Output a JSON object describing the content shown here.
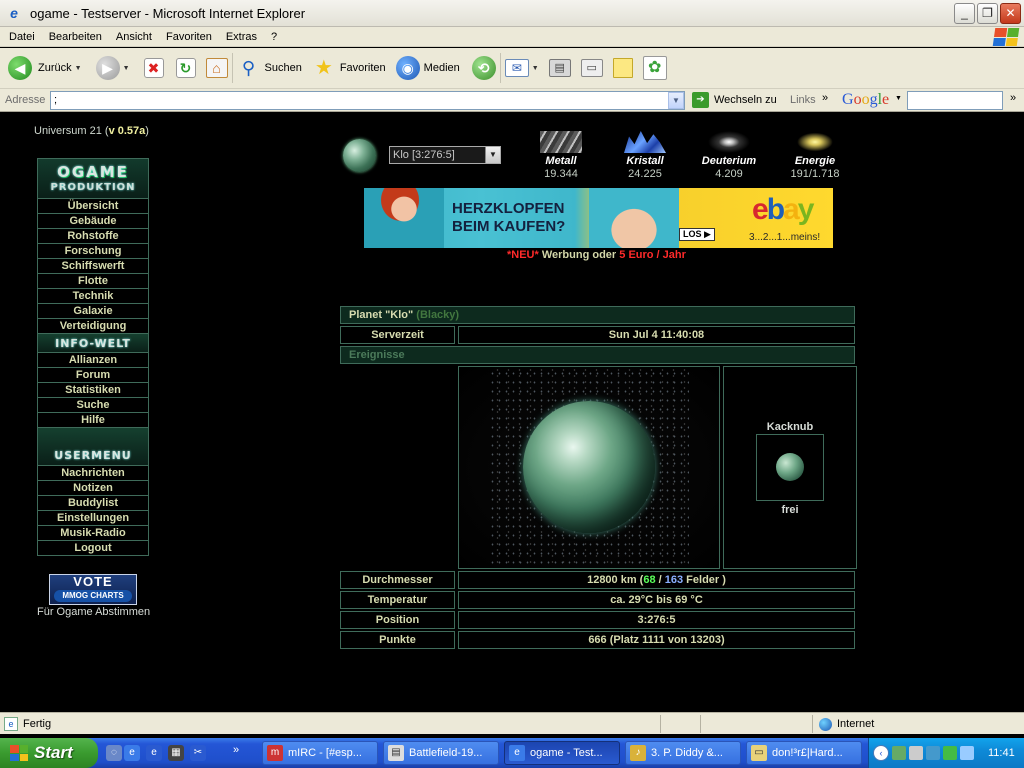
{
  "window": {
    "title": "ogame - Testserver - Microsoft Internet Explorer"
  },
  "menu": [
    "Datei",
    "Bearbeiten",
    "Ansicht",
    "Favoriten",
    "Extras",
    "?"
  ],
  "toolbar": {
    "back": "Zurück",
    "search": "Suchen",
    "favorites": "Favoriten",
    "media": "Medien"
  },
  "address": {
    "label": "Adresse",
    "value": ";",
    "go": "Wechseln zu",
    "links": "Links",
    "google": "Google"
  },
  "page": {
    "universe": {
      "label": "Universum 21 (",
      "version": "v 0.57a",
      "close": ")"
    },
    "sidebar": {
      "header_top": "OGAME",
      "header_bottom": "PRODUKTION",
      "production": [
        "Übersicht",
        "Gebäude",
        "Rohstoffe",
        "Forschung",
        "Schiffswerft",
        "Flotte",
        "Technik",
        "Galaxie",
        "Verteidigung"
      ],
      "info_header": "INFO-WELT",
      "info": [
        "Allianzen",
        "Forum",
        "Statistiken",
        "Suche",
        "Hilfe"
      ],
      "user_header": "USERMENU",
      "user": [
        "Nachrichten",
        "Notizen",
        "Buddylist",
        "Einstellungen",
        "Musik-Radio",
        "Logout"
      ],
      "vote_top": "VOTE",
      "vote_bottom": "MMOG CHARTS",
      "vote_text": "Für Ogame Abstimmen"
    },
    "planet_select": "Klo [3:276:5]",
    "resources": [
      {
        "name": "Metall",
        "value": "19.344"
      },
      {
        "name": "Kristall",
        "value": "24.225"
      },
      {
        "name": "Deuterium",
        "value": "4.209"
      },
      {
        "name": "Energie",
        "value": "191/1.718"
      }
    ],
    "banner": {
      "line1": "HERZKLOPFEN",
      "line2": "BEIM KAUFEN?",
      "button": "LOS ▶",
      "slogan": "3...2...1...meins!"
    },
    "adline": {
      "new": "*NEU*",
      "middle": " Werbung oder ",
      "price": "5 Euro / Jahr"
    },
    "overview": {
      "planet_title": "Planet \"Klo\"",
      "owner": "(Blacky)",
      "servertime_label": "Serverzeit",
      "servertime": "Sun Jul 4 11:40:08",
      "events_label": "Ereignisse",
      "moon_name": "Kacknub",
      "moon_status": "frei",
      "diameter_label": "Durchmesser",
      "diameter_km": "12800 km (",
      "fields_used": "68",
      "fields_sep": " / ",
      "fields_total": "163",
      "fields_suffix": " Felder )",
      "temperature_label": "Temperatur",
      "temperature": "ca. 29°C bis 69 °C",
      "position_label": "Position",
      "position": "3:276:5",
      "points_label": "Punkte",
      "points": "666 (Platz 1111 von 13203)"
    }
  },
  "statusbar": {
    "text": "Fertig",
    "zone": "Internet"
  },
  "taskbar": {
    "start": "Start",
    "tasks": [
      "mIRC - [#esp...",
      "Battlefield-19...",
      "ogame - Test...",
      "3. P. Diddy &...",
      "don!³r£|Hard..."
    ],
    "clock": "11:41"
  }
}
